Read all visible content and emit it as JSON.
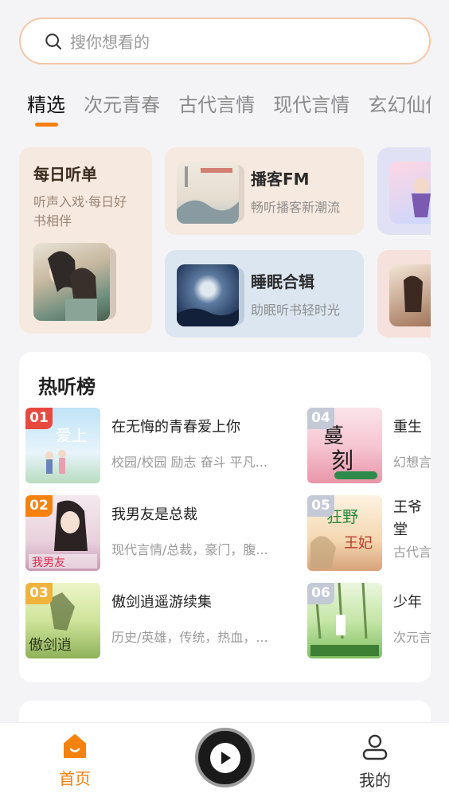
{
  "search": {
    "placeholder": "搜你想看的"
  },
  "tabs": [
    {
      "label": "精选",
      "active": true
    },
    {
      "label": "次元青春"
    },
    {
      "label": "古代言情"
    },
    {
      "label": "现代言情"
    },
    {
      "label": "玄幻仙侠"
    }
  ],
  "daily": {
    "title": "每日听单",
    "subtitle": "听声入戏·每日好书相伴"
  },
  "podcast": {
    "title": "播客FM",
    "subtitle": "畅听播客新潮流"
  },
  "sleep": {
    "title": "睡眠合辑",
    "subtitle": "助眠听书轻时光"
  },
  "hot_list": {
    "title": "热听榜",
    "items": [
      {
        "rank": "01",
        "name": "在无悔的青春爱上你",
        "tags": "校园/校园 励志 奋斗 平凡..."
      },
      {
        "rank": "02",
        "name": "我男友是总裁",
        "tags": "现代言情/总裁，豪门，腹..."
      },
      {
        "rank": "03",
        "name": "傲剑逍遥游续集",
        "tags": "历史/英雄，传统，热血，..."
      },
      {
        "rank": "04",
        "name": "重生",
        "tags": "幻想言"
      },
      {
        "rank": "05",
        "name": "王爷",
        "name2": "堂",
        "tags": "古代言"
      },
      {
        "rank": "06",
        "name": "少年",
        "tags": "次元言"
      }
    ]
  },
  "nav": {
    "home": "首页",
    "mine": "我的"
  },
  "colors": {
    "accent": "#f5810f"
  }
}
